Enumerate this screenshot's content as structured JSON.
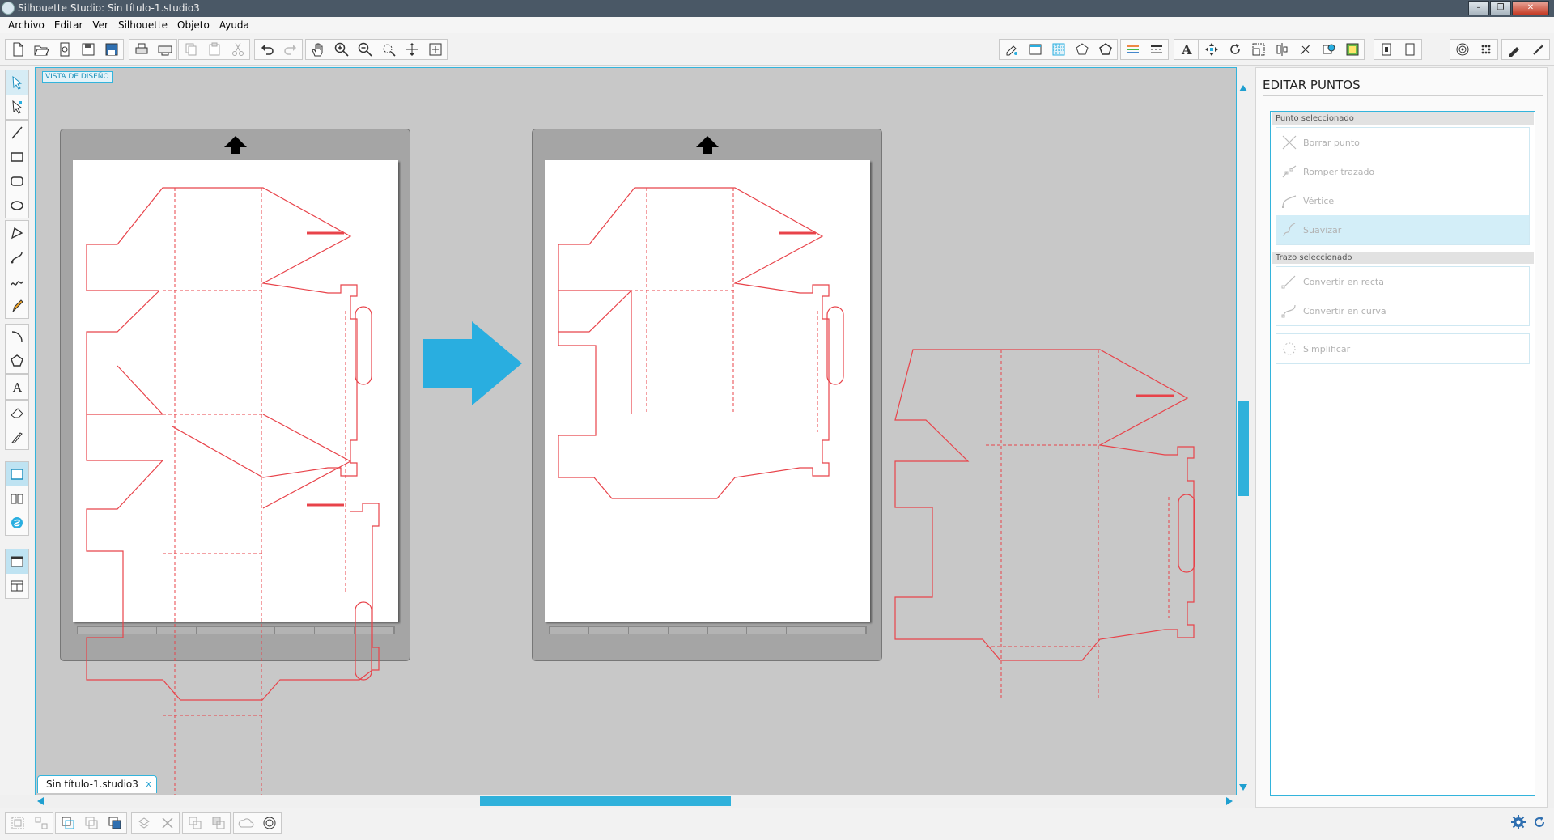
{
  "window": {
    "title": "Silhouette Studio: Sin título-1.studio3",
    "buttons": [
      "–",
      "❐",
      "✕"
    ]
  },
  "menu": [
    "Archivo",
    "Editar",
    "Ver",
    "Silhouette",
    "Objeto",
    "Ayuda"
  ],
  "canvas": {
    "view_label": "VISTA DE DISEÑO",
    "collapse_glyph": "»"
  },
  "document_tab": {
    "name": "Sin título-1.studio3",
    "close": "x"
  },
  "panel": {
    "title": "EDITAR PUNTOS",
    "point_section": {
      "label": "Punto seleccionado",
      "options": [
        {
          "label": "Borrar punto",
          "icon": "delete-point-icon"
        },
        {
          "label": "Romper trazado",
          "icon": "break-path-icon"
        },
        {
          "label": "Vértice",
          "icon": "corner-icon"
        },
        {
          "label": "Suavizar",
          "icon": "smooth-icon",
          "active": true
        }
      ]
    },
    "path_section": {
      "label": "Trazo seleccionado",
      "options": [
        {
          "label": "Convertir en recta",
          "icon": "make-straight-icon"
        },
        {
          "label": "Convertir en curva",
          "icon": "make-curve-icon"
        }
      ]
    },
    "simplify_label": "Simplificar"
  },
  "colors": {
    "accent": "#33b4dc",
    "cut_line": "#e8434a",
    "arrow": "#29aee0"
  }
}
